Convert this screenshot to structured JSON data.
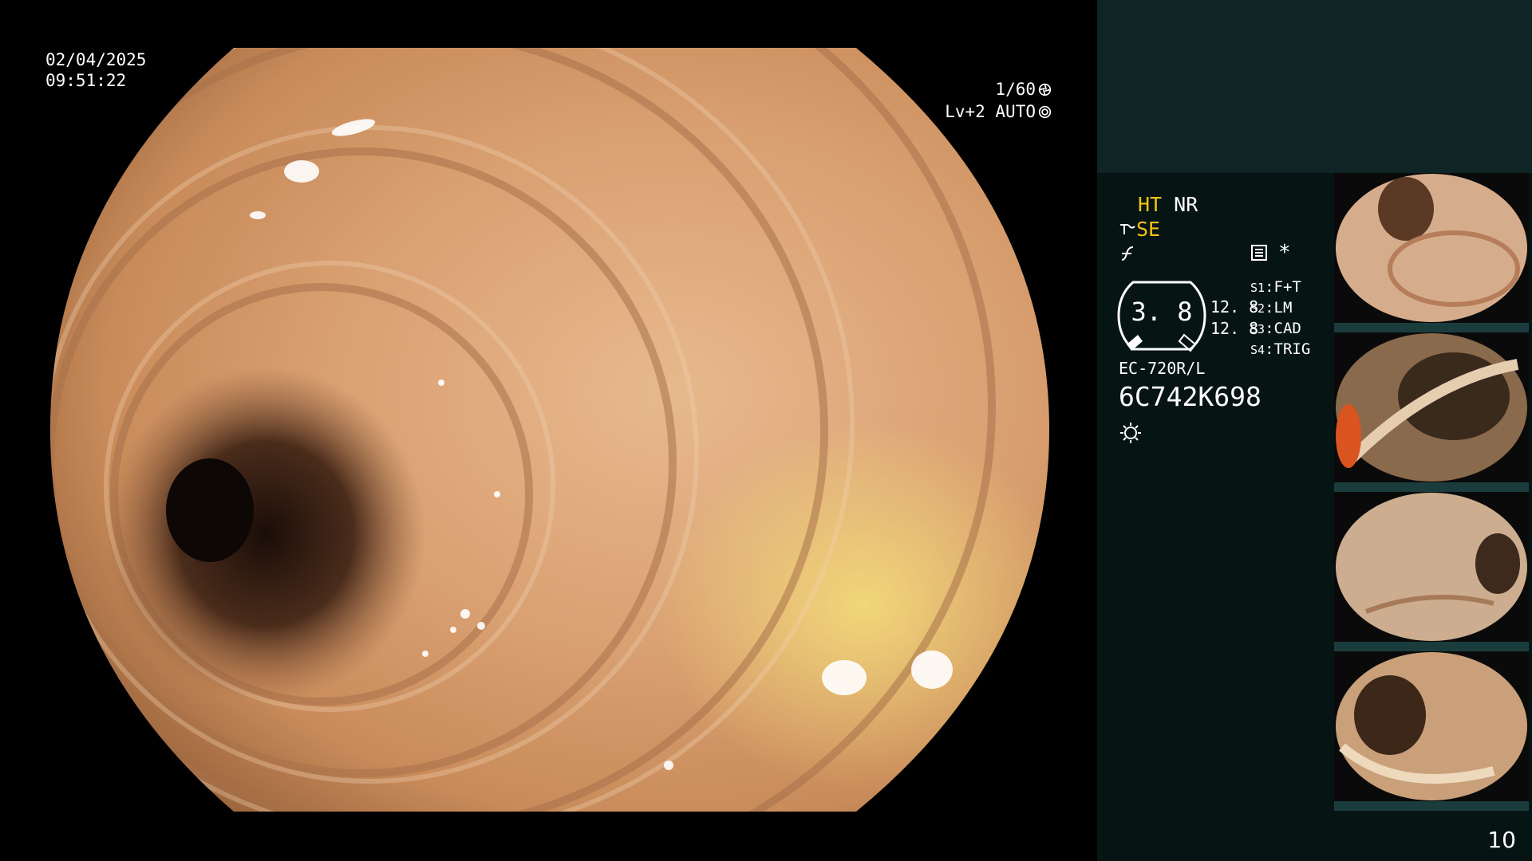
{
  "osd": {
    "date": "02/04/2025",
    "time": "09:51:22",
    "shutter": "1/60",
    "exposure": "Lv+2 AUTO"
  },
  "panel": {
    "mode_ht": "HT",
    "mode_nr": "NR",
    "mode_se": "SE",
    "gauge_value": "3. 8",
    "zoom_values": [
      "12. 8",
      "12. 8"
    ],
    "asterisk": "*",
    "switches": [
      {
        "key": "S1",
        "value": "F+T"
      },
      {
        "key": "S2",
        "value": "LM"
      },
      {
        "key": "S3",
        "value": "CAD"
      },
      {
        "key": "S4",
        "value": "TRIG"
      }
    ],
    "scope_model": "EC-720R/L",
    "scope_serial": "6C742K698"
  },
  "page_number": "10",
  "icons": {
    "shutter": "aperture-icon",
    "exposure": "exposure-icon",
    "f": "f-curve-icon",
    "memo": "memo-icon",
    "light": "light-source-icon"
  },
  "colors": {
    "highlight": "#f5c316",
    "panel_bg": "#071414",
    "panel_top_bg": "#0f2424"
  }
}
